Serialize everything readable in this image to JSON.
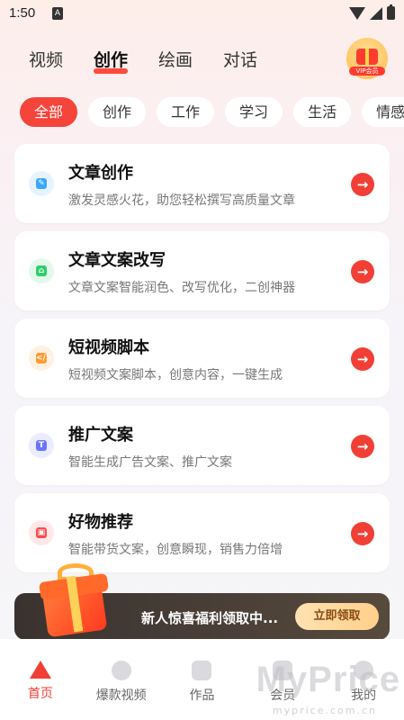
{
  "status_bar": {
    "time": "1:50",
    "app_indicator": "A"
  },
  "top_tabs": [
    {
      "label": "视频"
    },
    {
      "label": "创作"
    },
    {
      "label": "绘画"
    },
    {
      "label": "对话"
    }
  ],
  "active_tab": "创作",
  "vip": {
    "label": "VIP会员"
  },
  "chips": [
    "全部",
    "创作",
    "工作",
    "学习",
    "生活",
    "情感"
  ],
  "cards": [
    {
      "title": "文章创作",
      "desc": "激发灵感火花，助您轻松撰写高质量文章",
      "icon": "pen-icon",
      "color": "#3aa6ff"
    },
    {
      "title": "文章文案改写",
      "desc": "文章文案智能润色、改写优化，二创神器",
      "icon": "house-edit-icon",
      "color": "#2fcf6a"
    },
    {
      "title": "短视频脚本",
      "desc": "短视频文案脚本，创意内容，一键生成",
      "icon": "code-icon",
      "color": "#ff9a2e"
    },
    {
      "title": "推广文案",
      "desc": "智能生成广告文案、推广文案",
      "icon": "text-t-icon",
      "color": "#6a74ff"
    },
    {
      "title": "好物推荐",
      "desc": "智能带货文案，创意瞬现，销售力倍增",
      "icon": "bag-icon",
      "color": "#ff4a4a"
    }
  ],
  "promo": {
    "text": "新人惊喜福利领取中...",
    "button": "立即领取"
  },
  "bottom_nav": [
    {
      "label": "首页"
    },
    {
      "label": "爆款视频"
    },
    {
      "label": "作品"
    },
    {
      "label": "会员"
    },
    {
      "label": "我的"
    }
  ],
  "watermark": {
    "main": "MyPrice",
    "sub": "myprice.com.cn"
  }
}
